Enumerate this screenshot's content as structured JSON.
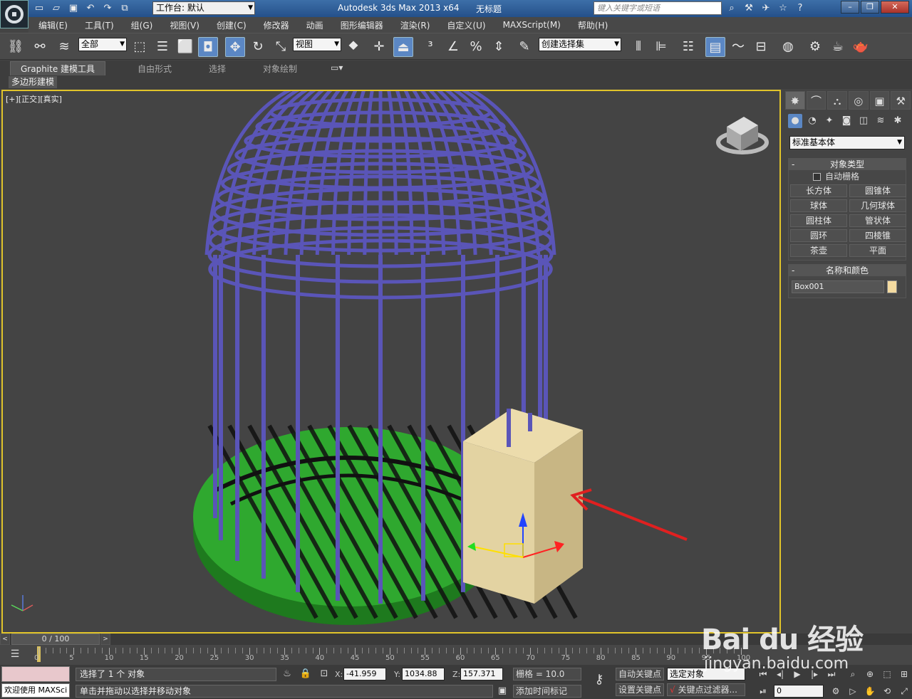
{
  "app": {
    "title": "Autodesk 3ds Max  2013 x64",
    "document": "无标题",
    "workspace_label": "工作台: 默认",
    "search_placeholder": "键入关键字或短语"
  },
  "menu": [
    "编辑(E)",
    "工具(T)",
    "组(G)",
    "视图(V)",
    "创建(C)",
    "修改器",
    "动画",
    "图形编辑器",
    "渲染(R)",
    "自定义(U)",
    "MAXScript(M)",
    "帮助(H)"
  ],
  "toolbar": {
    "selection_filter": "全部",
    "ref_coord": "视图",
    "named_selection": "创建选择集"
  },
  "ribbon": {
    "tabs": [
      "Graphite 建模工具",
      "自由形式",
      "选择",
      "对象绘制"
    ],
    "sub_label": "多边形建模"
  },
  "viewport": {
    "label": "[+][正交][真实]"
  },
  "command_panel": {
    "category": "标准基本体",
    "object_type_header": "对象类型",
    "autogrid_label": "自动栅格",
    "object_buttons": [
      "长方体",
      "圆锥体",
      "球体",
      "几何球体",
      "圆柱体",
      "管状体",
      "圆环",
      "四棱锥",
      "茶壶",
      "平面"
    ],
    "name_color_header": "名称和颜色",
    "object_name": "Box001",
    "object_color": "#f4dba0"
  },
  "timeline": {
    "frame_display": "0 / 100",
    "ticks": [
      "0",
      "5",
      "10",
      "15",
      "20",
      "25",
      "30",
      "35",
      "40",
      "45",
      "50",
      "55",
      "60",
      "65",
      "70",
      "75",
      "80",
      "85",
      "90",
      "95",
      "100"
    ]
  },
  "status": {
    "maxscript_label": "欢迎使用 MAXSci",
    "selected": "选择了 1 个 对象",
    "prompt": "单击并拖动以选择并移动对象",
    "x_label": "X:",
    "x": "-41.959",
    "y_label": "Y:",
    "y": "1034.88",
    "z_label": "Z:",
    "z": "157.371",
    "grid": "栅格 = 10.0",
    "add_time_tag": "添加时间标记",
    "auto_key": "自动关键点",
    "set_key": "设置关键点",
    "key_mode": "选定对象",
    "key_filters": "关键点过滤器...",
    "current_frame": "0"
  },
  "watermark": {
    "brand": "Bai du 经验",
    "url": "jingyan.baidu.com"
  },
  "colors": {
    "cage": "#5a55b8",
    "base": "#2fa82f",
    "box": "#e3d3a2",
    "highlight": "#e1c42a",
    "arrow": "#e02020"
  }
}
